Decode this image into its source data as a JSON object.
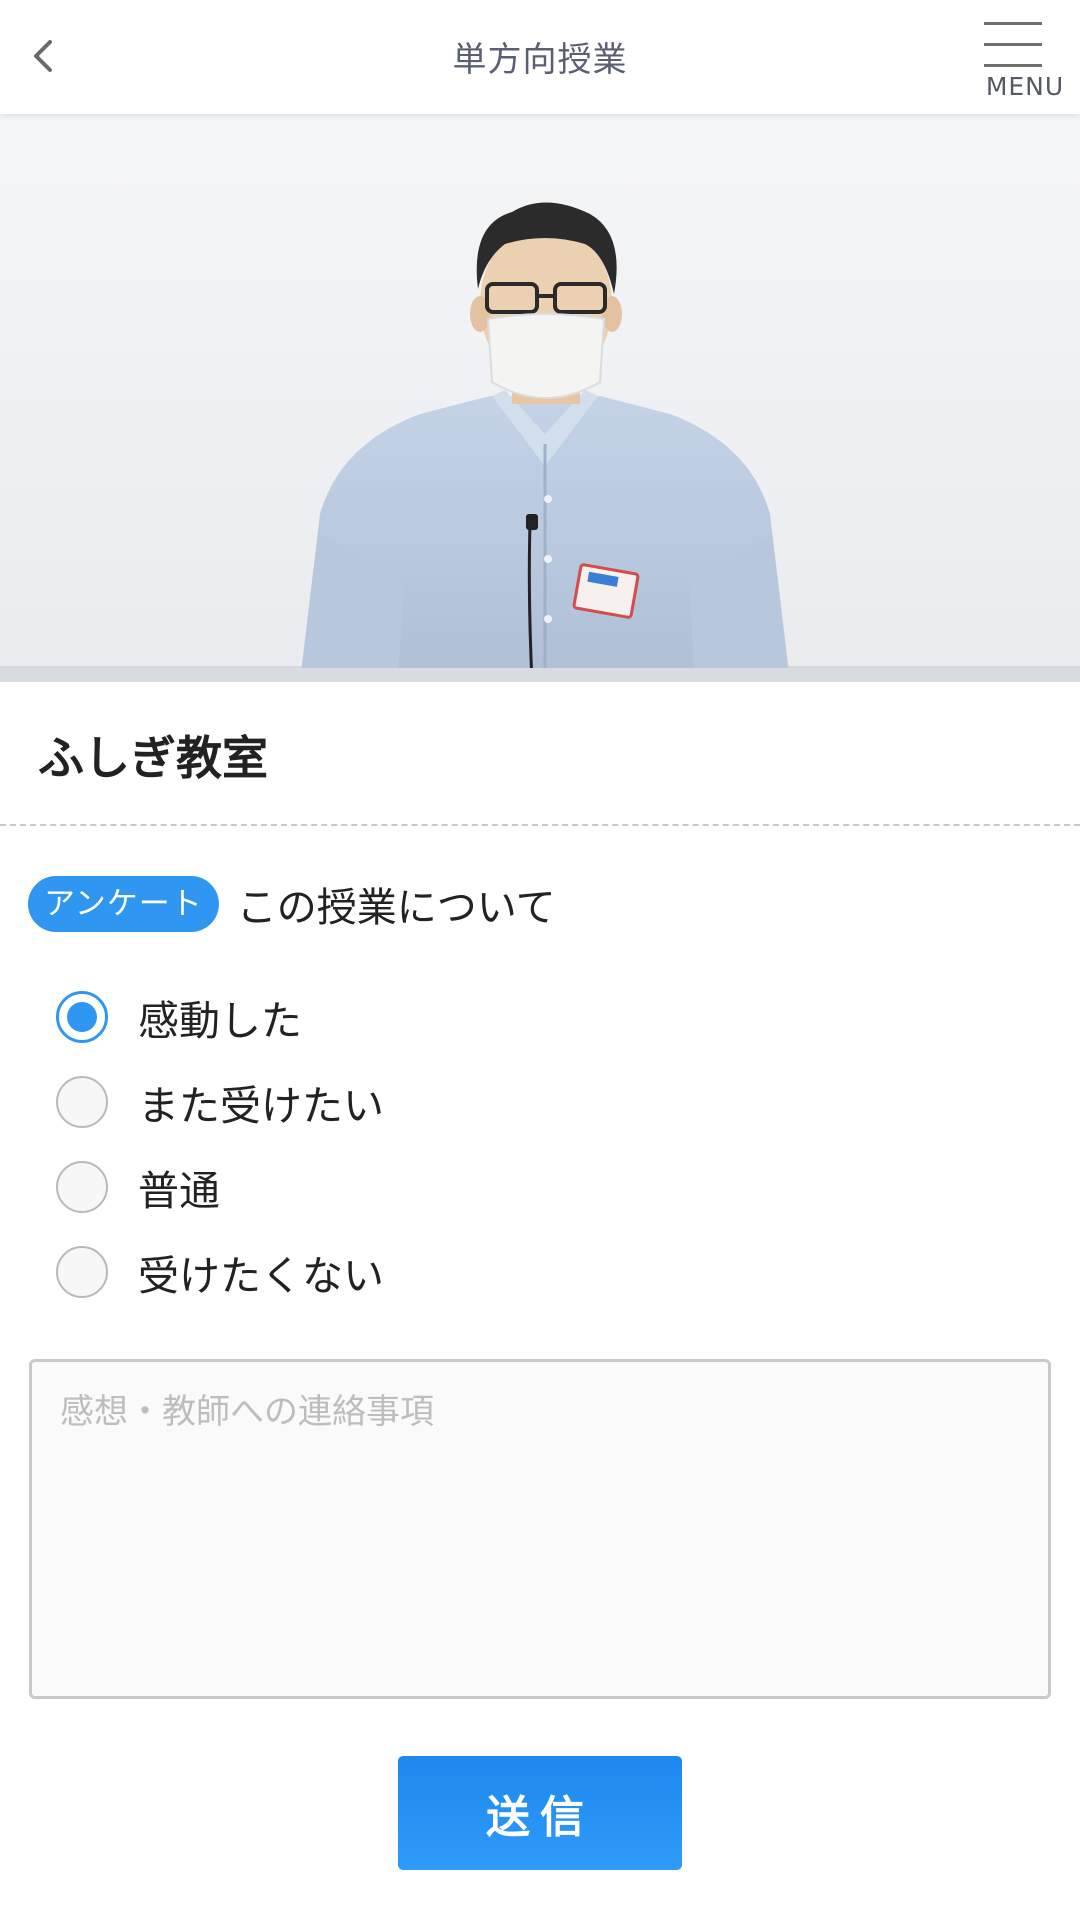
{
  "header": {
    "title": "単方向授業",
    "back_icon": "chevron-left-icon",
    "menu_icon": "hamburger-icon",
    "menu_label": "MENU"
  },
  "video": {
    "content": "lecture-video-frame"
  },
  "lesson": {
    "title": "ふしぎ教室"
  },
  "survey": {
    "badge": "アンケート",
    "question": "この授業について",
    "options": [
      {
        "label": "感動した",
        "selected": true
      },
      {
        "label": "また受けたい",
        "selected": false
      },
      {
        "label": "普通",
        "selected": false
      },
      {
        "label": "受けたくない",
        "selected": false
      }
    ]
  },
  "comment": {
    "value": "",
    "placeholder": "感想・教師への連絡事項"
  },
  "submit": {
    "label": "送信"
  },
  "colors": {
    "accent": "#2f96f2",
    "header_title": "#5b5f73",
    "text": "#222222",
    "placeholder": "#bdbdbd"
  }
}
